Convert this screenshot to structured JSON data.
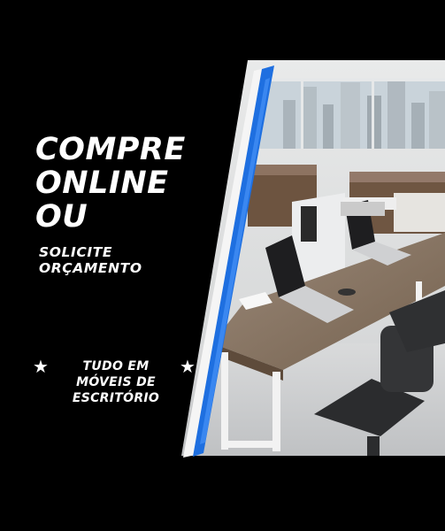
{
  "headline": {
    "line1": "COMPRE",
    "line2": "ONLINE",
    "line3": "OU"
  },
  "subheadline": {
    "line1": "SOLICITE",
    "line2": "ORÇAMENTO"
  },
  "tagline": {
    "line1": "TUDO EM",
    "line2": "MÓVEIS DE",
    "line3": "ESCRITÓRIO"
  },
  "icons": {
    "left_star": "star-icon",
    "right_star": "star-icon"
  },
  "colors": {
    "background": "#000000",
    "accent_blue": "#1e6fe0",
    "text": "#ffffff",
    "desk_wood": "#8a7765"
  }
}
